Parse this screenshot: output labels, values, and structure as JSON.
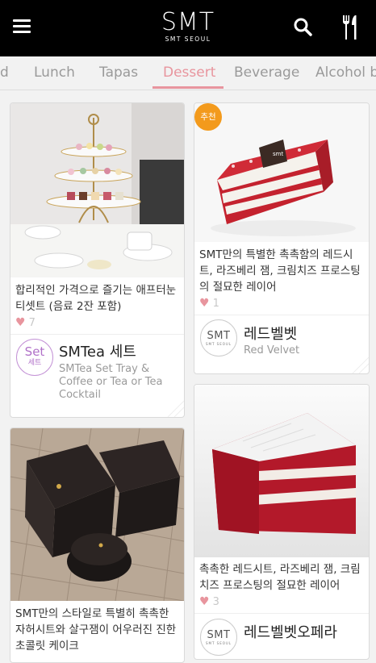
{
  "header": {
    "logo_text": "SMT",
    "logo_subtext": "SMT SEOUL"
  },
  "tabs": [
    {
      "label": "Brunch",
      "visible": "d"
    },
    {
      "label": "Lunch"
    },
    {
      "label": "Tapas"
    },
    {
      "label": "Dessert",
      "active": true
    },
    {
      "label": "Beverage"
    },
    {
      "label": "Alcohol beverage",
      "visible": "Alcohol b"
    }
  ],
  "tab_labels": {
    "partial_left": "d",
    "lunch": "Lunch",
    "tapas": "Tapas",
    "dessert": "Dessert",
    "beverage": "Beverage",
    "alcohol_partial": "Alcohol b"
  },
  "items": [
    {
      "description": "합리적인 가격으로 즐기는 애프터눈 티셋트 (음료 2잔 포함)",
      "likes": "7",
      "brand_badge": {
        "line1": "Set",
        "line2": "세트"
      },
      "name": "SMTea 세트",
      "sub": "SMTea Set Tray & Coffee or Tea or Tea Cocktail"
    },
    {
      "badge": "추천",
      "description": "SMT만의 특별한 촉촉함의 레드시트, 라즈베리 잼, 크림치즈 프로스팅의 절묘한 레이어",
      "likes": "1",
      "brand_badge": {
        "line1": "SMT",
        "line2": "SMT SEOUL"
      },
      "name": "레드벨벳",
      "sub": "Red Velvet"
    },
    {
      "description": "SMT만의 스타일로 특별히 촉촉한 자허시트와 살구잼이 어우러진 진한 초콜릿 케이크",
      "likes": "",
      "name": "",
      "sub": ""
    },
    {
      "description": "촉촉한 레드시트, 라즈베리 잼, 크림치즈 프로스팅의 절묘한 레이어",
      "likes": "3",
      "brand_badge": {
        "line1": "SMT",
        "line2": "SMT SEOUL"
      },
      "name": "레드벨벳오페라",
      "sub": ""
    }
  ],
  "colors": {
    "accent": "#e8959e",
    "header_bg": "#000000",
    "badge": "#f39a1c",
    "set_purple": "#b070c8"
  },
  "icons": [
    "menu-icon",
    "search-icon",
    "cutlery-icon",
    "heart-icon"
  ]
}
